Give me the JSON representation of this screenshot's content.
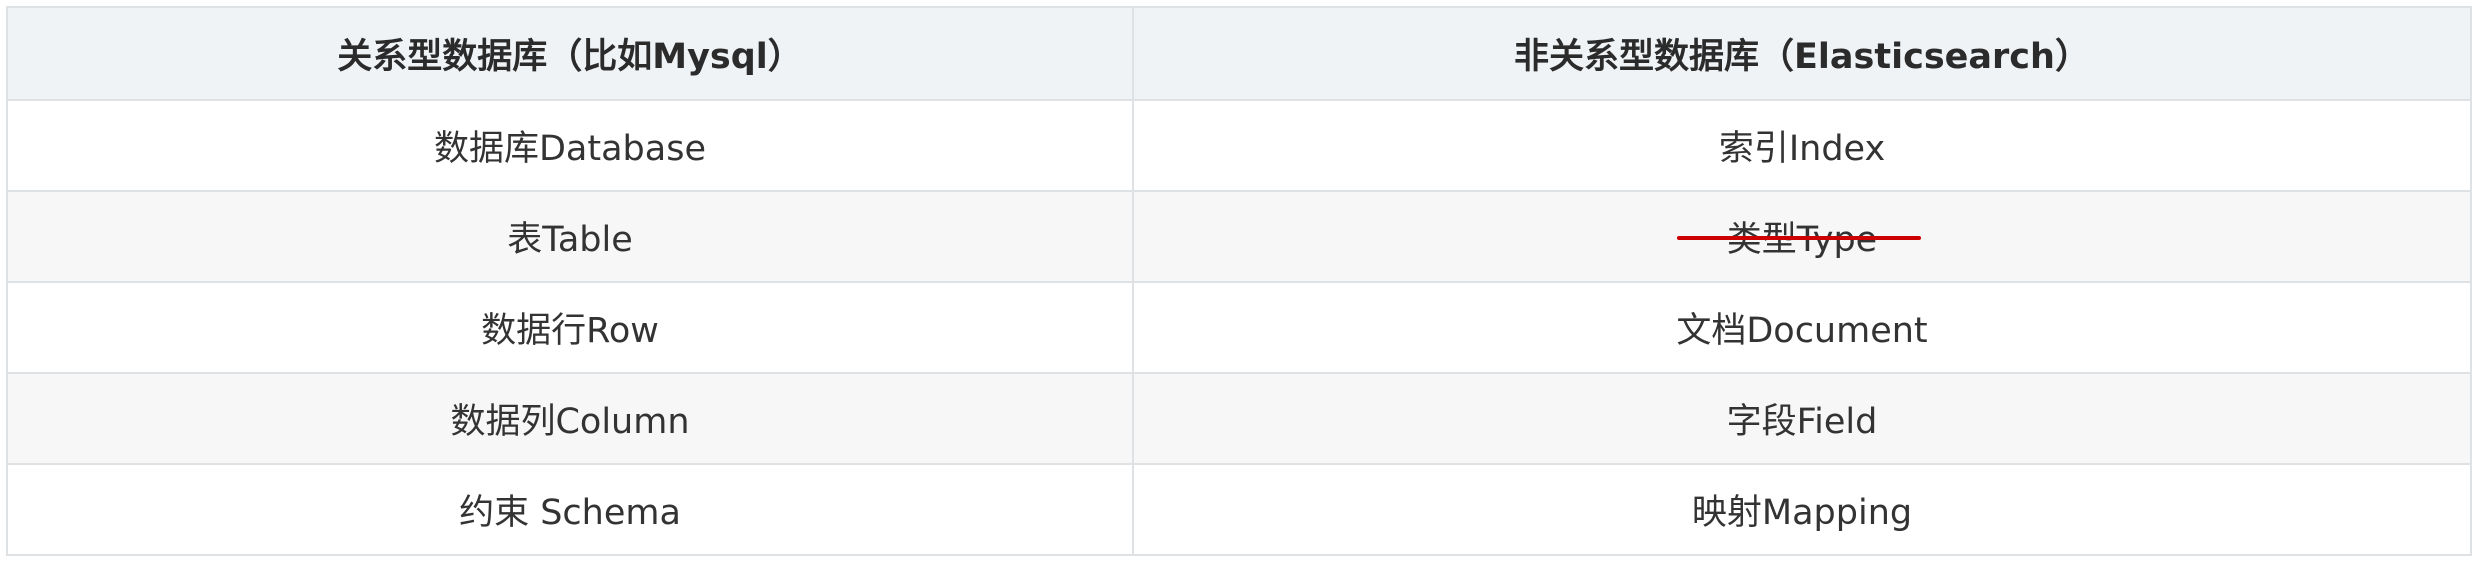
{
  "table": {
    "headers": [
      "关系型数据库（比如Mysql）",
      "非关系型数据库（Elasticsearch）"
    ],
    "rows": [
      [
        "数据库Database",
        "索引Index"
      ],
      [
        "表Table",
        "类型Type"
      ],
      [
        "数据行Row",
        "文档Document"
      ],
      [
        "数据列Column",
        "字段Field"
      ],
      [
        "约束 Schema",
        "映射Mapping"
      ]
    ],
    "strikethrough_cell": {
      "row": 1,
      "col": 1,
      "color": "#cc0000"
    }
  },
  "colors": {
    "header_bg": "#eff3f6",
    "even_row_bg": "#f7f7f7",
    "border": "#dfe2e5",
    "text": "#333333"
  }
}
